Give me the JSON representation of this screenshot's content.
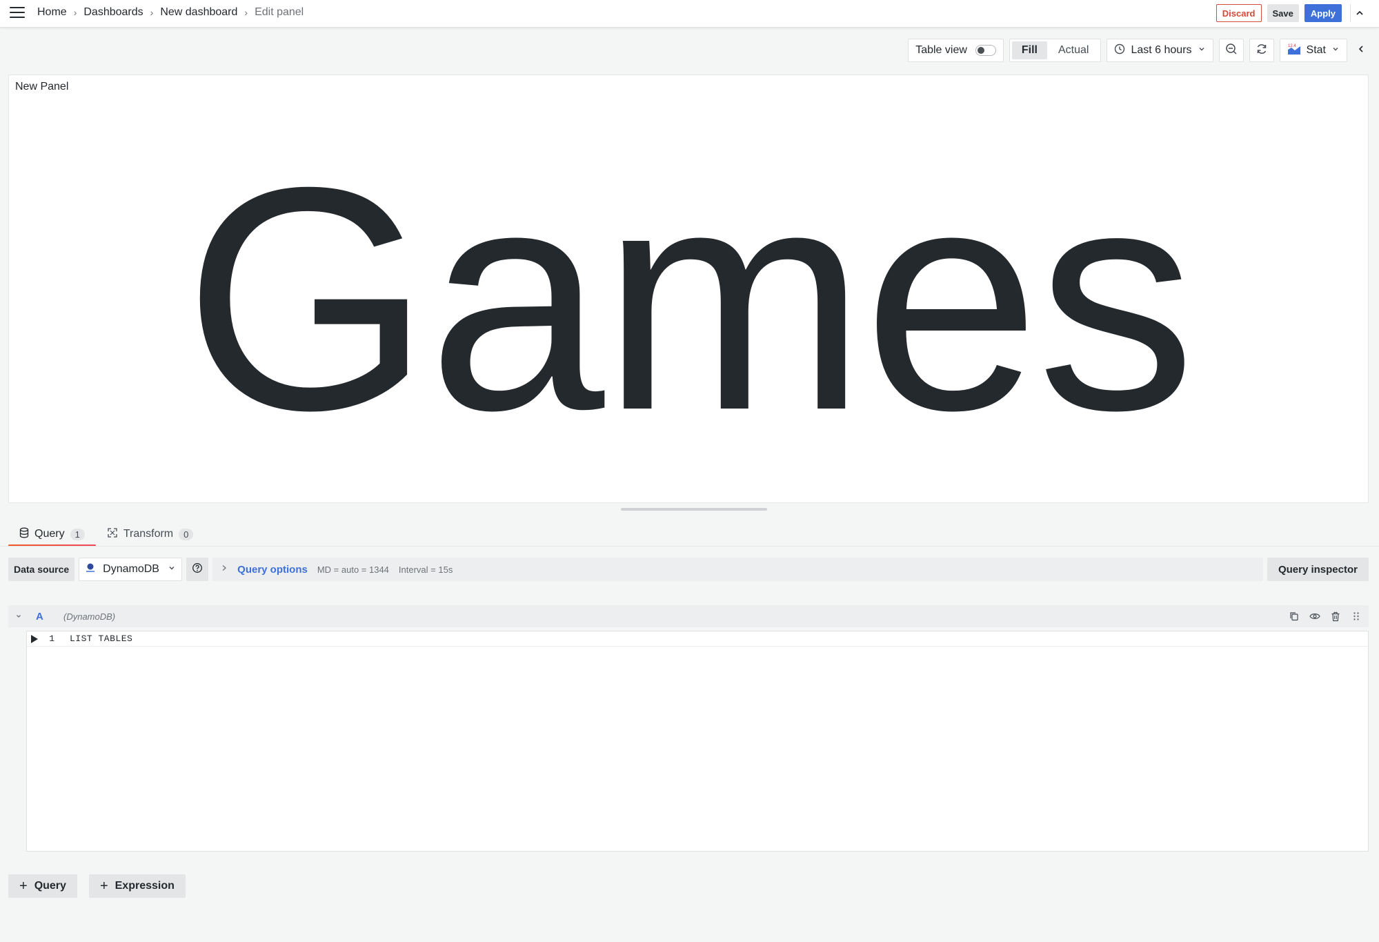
{
  "breadcrumb": {
    "home": "Home",
    "dashboards": "Dashboards",
    "dashboard": "New dashboard",
    "current": "Edit panel"
  },
  "actions": {
    "discard": "Discard",
    "save": "Save",
    "apply": "Apply"
  },
  "toolbar": {
    "table_view": "Table view",
    "fill": "Fill",
    "actual": "Actual",
    "time_range": "Last 6 hours",
    "visualization": "Stat"
  },
  "panel": {
    "title": "New Panel",
    "value": "Games"
  },
  "tabs": {
    "query_label": "Query",
    "query_count": "1",
    "transform_label": "Transform",
    "transform_count": "0"
  },
  "datasource": {
    "label": "Data source",
    "selected": "DynamoDB",
    "query_options": "Query options",
    "md": "MD = auto = 1344",
    "interval": "Interval = 15s",
    "inspector": "Query inspector"
  },
  "query": {
    "ref_id": "A",
    "ds_name": "(DynamoDB)",
    "line_number": "1",
    "code": "LIST TABLES"
  },
  "bottom": {
    "add_query": "Query",
    "add_expression": "Expression"
  },
  "colors": {
    "primary": "#3d71d9",
    "discard": "#d44a3a",
    "tab_active": "#f05a28"
  }
}
